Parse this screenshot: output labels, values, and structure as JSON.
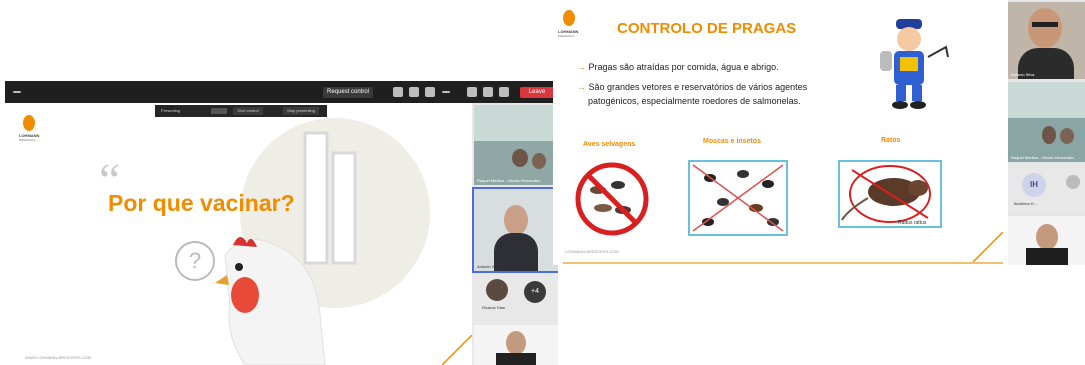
{
  "left": {
    "toolbar": {
      "request_control": "Request control",
      "leave": "Leave"
    },
    "sharing_bar": {
      "presenting": "Presenting",
      "give_control": "Give control",
      "stop_presenting": "Stop presenting"
    },
    "slide": {
      "logo_text": "LOHMANN",
      "logo_sub": "BREEDERS",
      "quote_mark": "“",
      "heading": "Por que vacinar?",
      "question_mark": "?",
      "footer_url": "WWW.LOHMANN-BREEDERS.COM"
    },
    "participants": [
      {
        "name": "Raquel Medina – Nicola Hernandez"
      },
      {
        "name": "Antonio Vieira"
      },
      {
        "name": "Ricardo Dias"
      },
      {
        "badge": "+4"
      }
    ]
  },
  "right": {
    "slide": {
      "logo_text": "LOHMANN",
      "logo_sub": "BREEDERS",
      "title": "CONTROLO DE PRAGAS",
      "bullet_1": "Pragas são atraídas por comida, água e abrigo.",
      "bullet_2_line1": "São grandes vetores e reservatórios de vários agentes",
      "bullet_2_line2": "patogénicos, especialmente roedores de salmonelas.",
      "label_aves": "Aves selvagens",
      "label_moscas": "Moscas e insetos",
      "label_ratos": "Ratos",
      "rat_caption": "Rattus rattus",
      "footer_url": "LOHMANN-BREEDERS.COM"
    },
    "participants": [
      {
        "name": "Antonio Silva"
      },
      {
        "name": "Raquel Medina – Nicola Hernandez"
      },
      {
        "initials": "IH",
        "name": "Ibrahima H..."
      },
      {
        "name": ""
      }
    ]
  },
  "colors": {
    "brand_orange": "#f08c00",
    "leave_red": "#d9363e",
    "toolbar_dark": "#1f1f1f"
  }
}
